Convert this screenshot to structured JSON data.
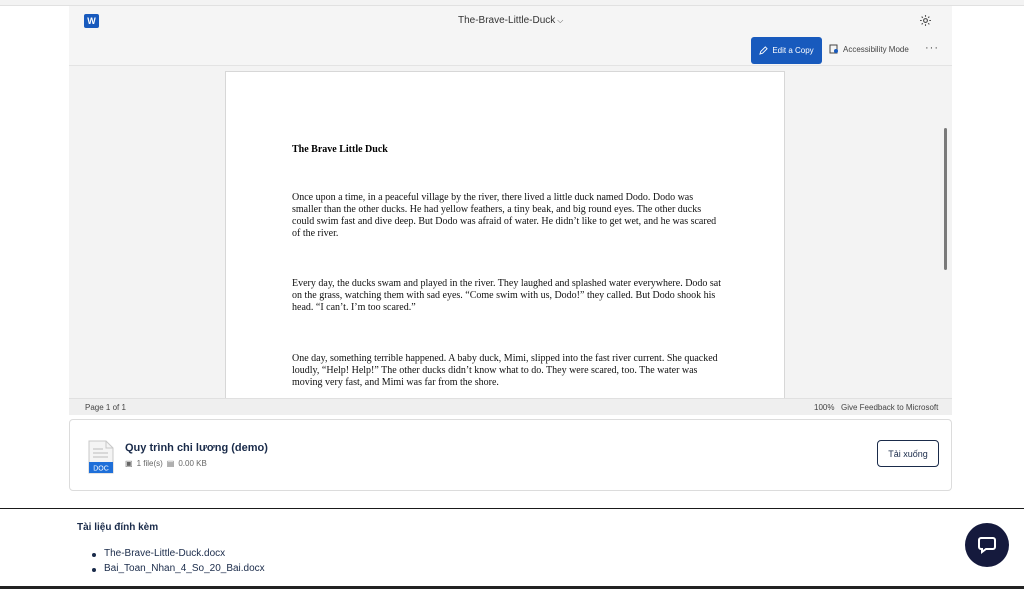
{
  "viewer": {
    "app_icon": "word-icon",
    "doc_title": "The-Brave-Little-Duck",
    "edit_label": "Edit a Copy",
    "accessibility_label": "Accessibility Mode",
    "more_label": "···"
  },
  "document": {
    "title": "The Brave Little Duck",
    "paragraphs": [
      "Once upon a time, in a peaceful village by the river, there lived a little duck named Dodo. Dodo was smaller than the other ducks. He had yellow feathers, a tiny beak, and big round eyes. The other ducks could swim fast and dive deep. But Dodo was afraid of water. He didn’t like to get wet, and he was scared of the river.",
      "Every day, the ducks swam and played in the river. They laughed and splashed water everywhere. Dodo sat on the grass, watching them with sad eyes. “Come swim with us, Dodo!” they called. But Dodo shook his head. “I can’t. I’m too scared.”",
      "One day, something terrible happened. A baby duck, Mimi, slipped into the fast river current. She quacked loudly, “Help! Help!” The other ducks didn’t know what to do. They were scared, too. The water was moving very fast, and Mimi was far from the shore."
    ]
  },
  "status": {
    "page": "Page 1 of 1",
    "zoom": "100%",
    "feedback": "Give Feedback to Microsoft"
  },
  "file": {
    "icon_label": "DOC",
    "name": "Quy trình chi lương (demo)",
    "count": "1 file(s)",
    "size": "0.00 KB",
    "download_label": "Tải xuống"
  },
  "attachments": {
    "title": "Tài liệu đính kèm",
    "items": [
      "The-Brave-Little-Duck.docx",
      "Bai_Toan_Nhan_4_So_20_Bai.docx"
    ]
  },
  "colors": {
    "word_blue": "#185abd",
    "navy": "#1a2b4a",
    "chat_bg": "#151a3d"
  }
}
